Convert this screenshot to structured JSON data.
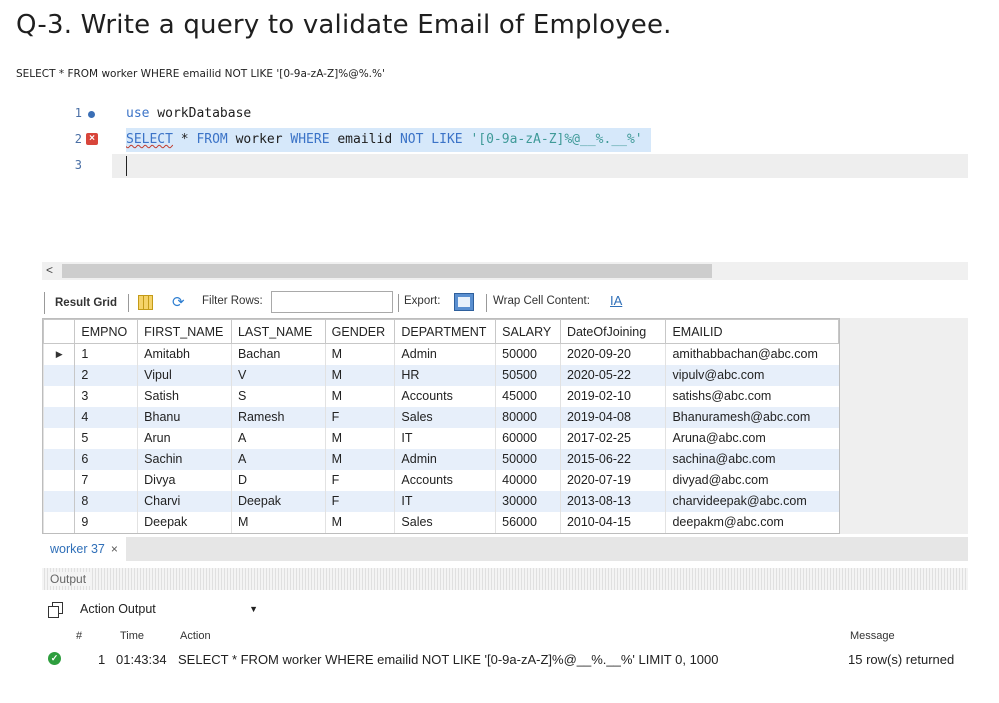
{
  "page": {
    "heading": "Q-3. Write a query to validate Email of Employee.",
    "query_text": "SELECT * FROM worker WHERE emailid NOT LIKE '[0-9a-zA-Z]%@%.%'"
  },
  "editor": {
    "lines": [
      {
        "number": "1",
        "marker": "dot",
        "tokens": [
          {
            "t": "use",
            "c": "kw"
          },
          {
            "t": " workDatabase",
            "c": "plain"
          }
        ]
      },
      {
        "number": "2",
        "marker": "error",
        "tokens": [
          {
            "t": "SELECT",
            "c": "kw-err"
          },
          {
            "t": " * ",
            "c": "plain"
          },
          {
            "t": "FROM",
            "c": "kw"
          },
          {
            "t": " worker ",
            "c": "plain"
          },
          {
            "t": "WHERE",
            "c": "kw"
          },
          {
            "t": " emailid ",
            "c": "plain"
          },
          {
            "t": "NOT LIKE",
            "c": "kw"
          },
          {
            "t": " ",
            "c": "plain"
          },
          {
            "t": "'[0-9a-zA-Z]%@__%.__%'",
            "c": "str"
          }
        ]
      },
      {
        "number": "3",
        "marker": "",
        "tokens": []
      }
    ]
  },
  "result_toolbar": {
    "result_grid": "Result Grid",
    "filter_rows": "Filter Rows:",
    "filter_value": "",
    "export": "Export:",
    "wrap_cell": "Wrap Cell Content:",
    "grid_icon": "grid-view-icon",
    "refresh_icon": "refresh-icon",
    "export_icon": "export-icon",
    "wrap_icon": "wrap-text-icon"
  },
  "grid": {
    "columns": [
      "EMPNO",
      "FIRST_NAME",
      "LAST_NAME",
      "GENDER",
      "DEPARTMENT",
      "SALARY",
      "DateOfJoining",
      "EMAILID"
    ],
    "rows": [
      [
        "1",
        "Amitabh",
        "Bachan",
        "M",
        "Admin",
        "50000",
        "2020-09-20",
        "amithabbachan@abc.com"
      ],
      [
        "2",
        "Vipul",
        "V",
        "M",
        "HR",
        "50500",
        "2020-05-22",
        "vipulv@abc.com"
      ],
      [
        "3",
        "Satish",
        "S",
        "M",
        "Accounts",
        "45000",
        "2019-02-10",
        "satishs@abc.com"
      ],
      [
        "4",
        "Bhanu",
        "Ramesh",
        "F",
        "Sales",
        "80000",
        "2019-04-08",
        "Bhanuramesh@abc.com"
      ],
      [
        "5",
        "Arun",
        "A",
        "M",
        "IT",
        "60000",
        "2017-02-25",
        "Aruna@abc.com"
      ],
      [
        "6",
        "Sachin",
        "A",
        "M",
        "Admin",
        "50000",
        "2015-06-22",
        "sachina@abc.com"
      ],
      [
        "7",
        "Divya",
        "D",
        "F",
        "Accounts",
        "40000",
        "2020-07-19",
        "divyad@abc.com"
      ],
      [
        "8",
        "Charvi",
        "Deepak",
        "F",
        "IT",
        "30000",
        "2013-08-13",
        "charvideepak@abc.com"
      ],
      [
        "9",
        "Deepak",
        "M",
        "M",
        "Sales",
        "56000",
        "2010-04-15",
        "deepakm@abc.com"
      ]
    ],
    "current_row_indicator": "▶"
  },
  "result_tab": {
    "label": "worker 37",
    "close": "×"
  },
  "output": {
    "title": "Output",
    "selector": "Action Output",
    "headers": {
      "num": "#",
      "time": "Time",
      "action": "Action",
      "message": "Message"
    },
    "entry": {
      "status_icon": "success-check-icon",
      "num": "1",
      "time": "01:43:34",
      "action": "SELECT * FROM worker WHERE emailid NOT LIKE '[0-9a-zA-Z]%@__%.__%' LIMIT 0, 1000",
      "message": "15 row(s) returned"
    }
  },
  "colors": {
    "keyword": "#3b73c7",
    "string": "#3f9a98",
    "selection": "#d6e8fa",
    "alt_row": "#e7effa",
    "error": "#d8453a",
    "success": "#2e9e3e"
  }
}
